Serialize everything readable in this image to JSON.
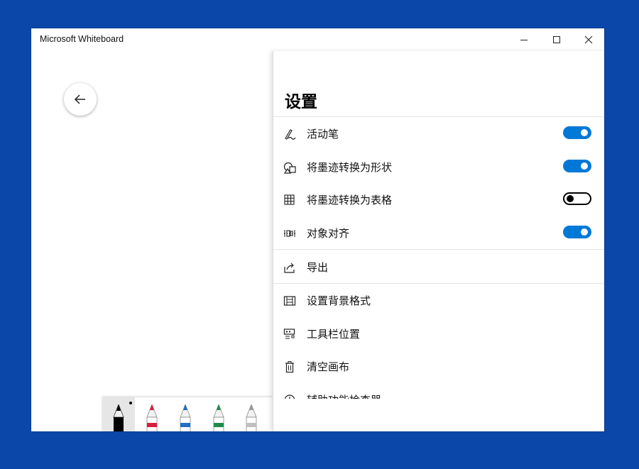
{
  "window": {
    "title": "Microsoft Whiteboard",
    "controls": [
      "minimize-icon",
      "maximize-icon",
      "close-icon"
    ]
  },
  "canvas": {
    "back_button_icon": "arrow-left-icon",
    "pens": [
      {
        "name": "black",
        "color": "#000000",
        "selected": true
      },
      {
        "name": "red",
        "color": "#d81e3c"
      },
      {
        "name": "blue",
        "color": "#1f6fc5"
      },
      {
        "name": "green",
        "color": "#1e8a4b"
      },
      {
        "name": "silver",
        "color": "#bfbfbf"
      }
    ]
  },
  "settings": {
    "title": "设置",
    "toggles": [
      {
        "label": "活动笔",
        "icon": "pen-icon",
        "on": true
      },
      {
        "label": "将墨迹转换为形状",
        "icon": "shapes-icon",
        "on": true
      },
      {
        "label": "将墨迹转换为表格",
        "icon": "table-icon",
        "on": false
      },
      {
        "label": "对象对齐",
        "icon": "align-icon",
        "on": true
      }
    ],
    "export": {
      "label": "导出",
      "icon": "share-icon"
    },
    "items": [
      {
        "label": "设置背景格式",
        "icon": "background-icon"
      },
      {
        "label": "工具栏位置",
        "icon": "toolbar-icon"
      },
      {
        "label": "清空画布",
        "icon": "trash-icon"
      },
      {
        "label": "辅助功能检查器",
        "icon": "accessibility-icon"
      }
    ],
    "accent_color": "#0078d7"
  }
}
